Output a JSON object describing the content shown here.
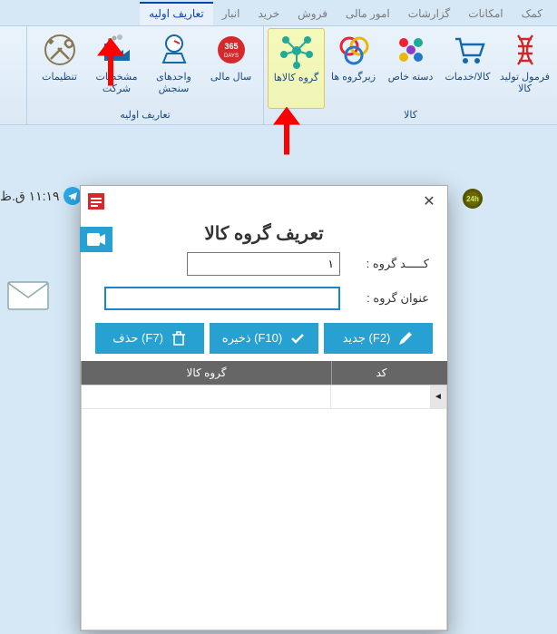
{
  "tabs": {
    "help": "کمک",
    "facilities": "امکانات",
    "reports": "گزارشات",
    "finance": "امور مالی",
    "sales": "فروش",
    "purchase": "خرید",
    "warehouse": "انبار",
    "initial": "تعاریف اولیه"
  },
  "ribbon": {
    "group_goods_title": "کالا",
    "group_initial_title": "تعاریف اولیه",
    "items": {
      "formula": "فرمول تولید کالا",
      "goods_services": "کالا/خدمات",
      "special_category": "دسته خاص",
      "subgroups": "زیرگروه ها",
      "goods_groups": "گروه کالاها",
      "fiscal_year": "سال مالی",
      "measure_units": "واحدهای سنجش",
      "company_spec": "مشخصات شرکت",
      "settings": "تنظیمات"
    }
  },
  "clock": "۱۱:۱۹ ق.ظ",
  "support_text": "24h",
  "modal": {
    "title": "تعریف گروه کالا",
    "code_label": "کـــــد گروه  :",
    "code_value": "۱",
    "name_label": "عنوان گروه  :",
    "name_value": "",
    "btn_new": "(F2) جدید",
    "btn_save": "(F10) ذخیره",
    "btn_delete": "(F7) حذف",
    "col_code": "کد",
    "col_group": "گروه کالا"
  }
}
